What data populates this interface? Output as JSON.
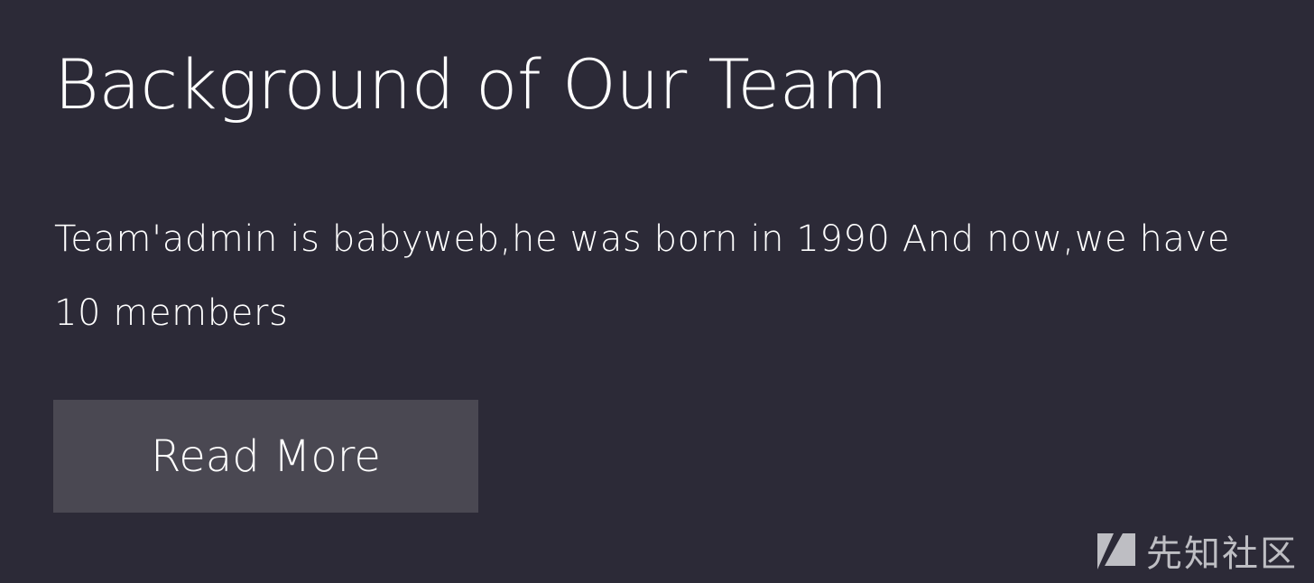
{
  "hero": {
    "title": "Background of Our Team",
    "description": "Team'admin is babyweb,he was born in 1990 And now,we have 10 members",
    "button_label": "Read More"
  },
  "watermark": {
    "text": "先知社区",
    "logo_icon": "xianzhi-logo-icon"
  },
  "colors": {
    "background": "#2c2a37",
    "button_background": "#4a4852",
    "text": "#ffffff",
    "watermark_text": "#d8d8dc"
  }
}
